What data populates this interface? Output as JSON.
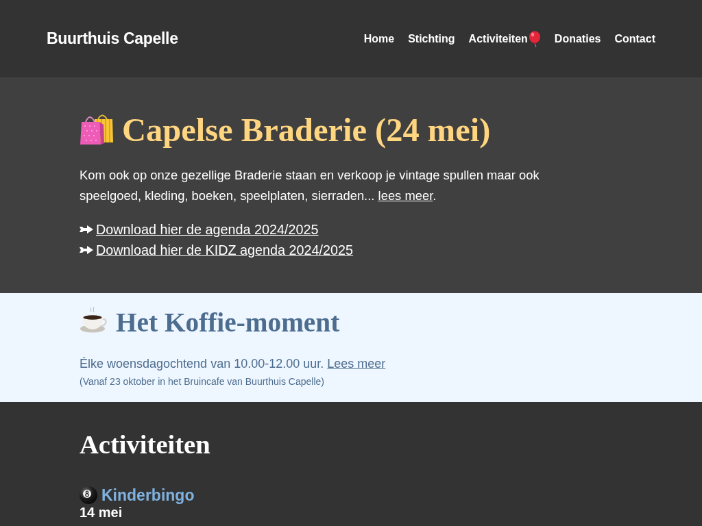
{
  "navbar": {
    "brand": "Buurthuis Capelle",
    "links": [
      {
        "label": "Home",
        "kind": "text"
      },
      {
        "label": "Stichting",
        "kind": "text"
      },
      {
        "label": "Activiteiten",
        "kind": "text-icon"
      },
      {
        "label": "Donaties",
        "kind": "text"
      },
      {
        "label": "Contact",
        "kind": "text"
      }
    ]
  },
  "hero": {
    "title": "Capelse Braderie (24 mei)",
    "text": "Kom ook op onze gezellige Braderie staan en verkoop je vintage spullen maar ook speelgoed, kleding, boeken, speelplaten, sierraden...",
    "link": "lees meer",
    "text_end": ".",
    "downloads": [
      "Download hier de agenda 2024/2025",
      "Download hier de KIDZ agenda 2024/2025"
    ]
  },
  "coffee": {
    "title": "Het Koffie-moment",
    "text": "Élke woensdagochtend van 10.00-12.00 uur.",
    "link": "Lees meer",
    "note": "(Vanaf 23 oktober in het Bruincafe van Buurthuis Capelle)"
  },
  "activities": {
    "title": "Activiteiten",
    "items": [
      {
        "title": "Kinderbingo",
        "date": "14 mei"
      }
    ]
  }
}
